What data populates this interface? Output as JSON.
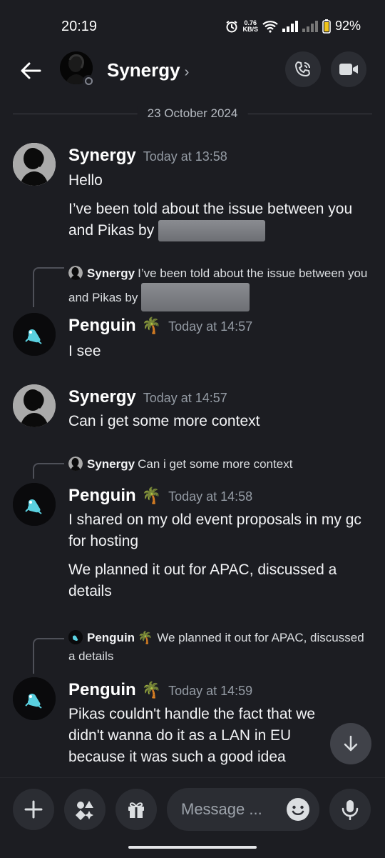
{
  "status_bar": {
    "time": "20:19",
    "speed_top": "0.76",
    "speed_unit": "KB/S",
    "battery": "92%"
  },
  "header": {
    "name": "Synergy",
    "chevron": "›",
    "back_icon": "arrow-left-icon",
    "call_icon": "phone-call-icon",
    "video_icon": "video-camera-icon"
  },
  "date_divider": "23 October 2024",
  "messages": [
    {
      "author": "Synergy",
      "time": "Today at 13:58",
      "lines": [
        "Hello",
        "I’ve been told about the issue between you and Pikas by"
      ]
    },
    {
      "reply": {
        "author": "Synergy",
        "text": "I’ve been told about the issue between you and Pikas by"
      },
      "author": "Penguin",
      "emoji": "🌴",
      "time": "Today at 14:57",
      "lines": [
        "I see"
      ]
    },
    {
      "author": "Synergy",
      "time": "Today at 14:57",
      "lines": [
        "Can i get some more context"
      ]
    },
    {
      "reply": {
        "author": "Synergy",
        "text": "Can i get some more context"
      },
      "author": "Penguin",
      "emoji": "🌴",
      "time": "Today at 14:58",
      "lines": [
        "I shared on my old event proposals in my gc for hosting",
        "We planned it out for APAC, discussed a details"
      ]
    },
    {
      "reply": {
        "author": "Penguin",
        "emoji": "🌴",
        "text": "We planned it out for APAC, discussed a details"
      },
      "author": "Penguin",
      "emoji": "🌴",
      "time": "Today at 14:59",
      "lines": [
        "Pikas couldn't handle the fact that we didn't wanna do it as a LAN in EU because it was such a good idea"
      ]
    }
  ],
  "composer": {
    "placeholder": "Message ...",
    "plus_icon": "plus-icon",
    "apps_icon": "apps-icon",
    "gift_icon": "gift-icon",
    "emoji_icon": "smile-icon",
    "mic_icon": "microphone-icon"
  },
  "scroll_down_icon": "arrow-down-icon"
}
